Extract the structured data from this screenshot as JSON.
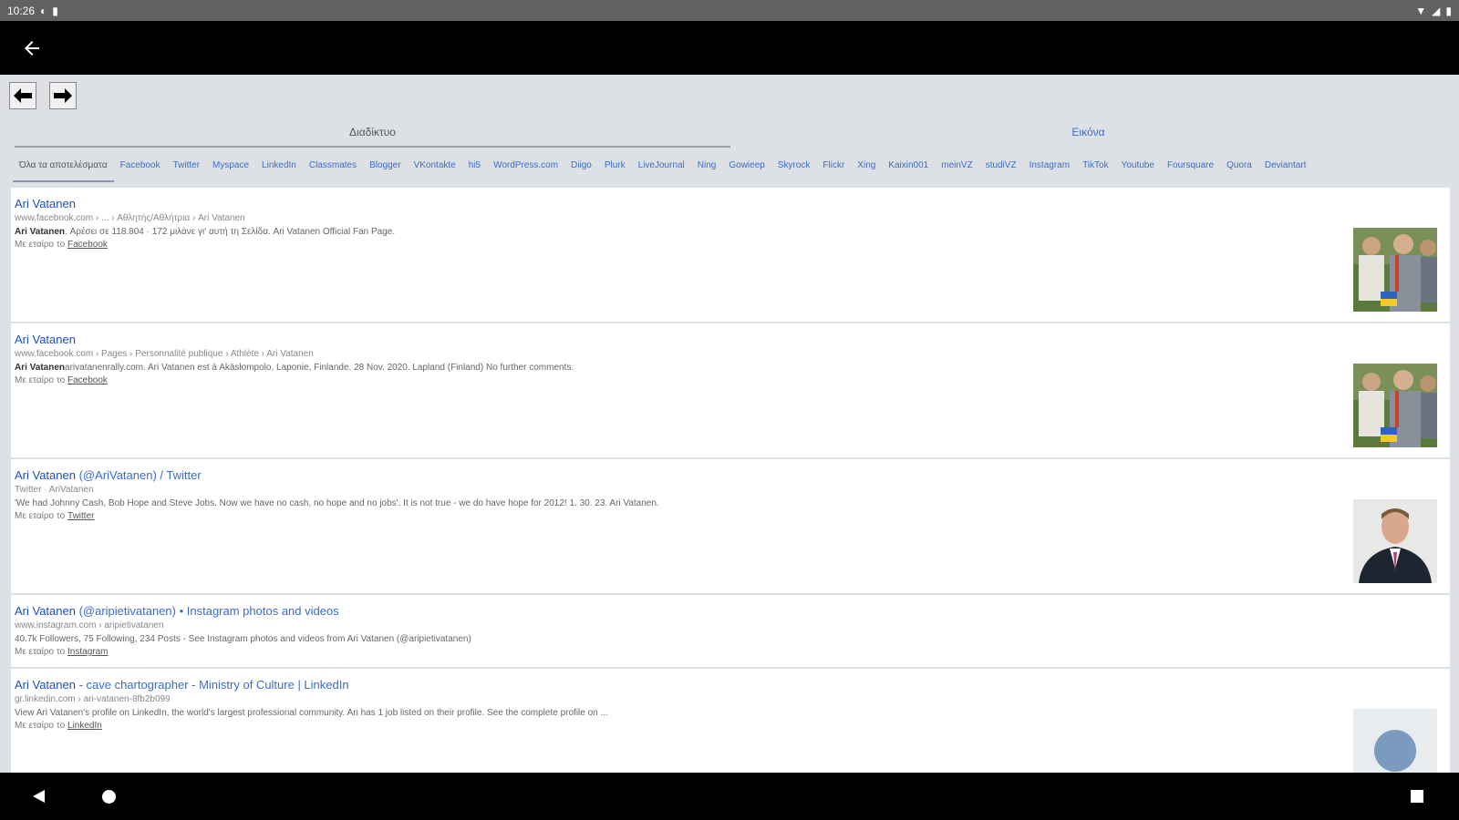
{
  "statusbar": {
    "time": "10:26"
  },
  "tabs": [
    "Διαδίκτυο",
    "Εικόνα"
  ],
  "chips": [
    "Όλα τα αποτελέσματα",
    "Facebook",
    "Twitter",
    "Myspace",
    "LinkedIn",
    "Classmates",
    "Blogger",
    "VKontakte",
    "hi5",
    "WordPress.com",
    "Diigo",
    "Plurk",
    "LiveJournal",
    "Ning",
    "Gowieep",
    "Skyrock",
    "Flickr",
    "Xing",
    "Kaixin001",
    "meinVZ",
    "studiVZ",
    "Instagram",
    "TikTok",
    "Youtube",
    "Foursquare",
    "Quora",
    "Deviantart"
  ],
  "results": [
    {
      "title": "Ari Vatanen",
      "title_rest": "",
      "url": "www.facebook.com › ... › Αθλητής/Αθλήτρια › Ari Vatanen",
      "snippet_bold": "Ari Vatanen",
      "snippet": ". Αρέσει σε 118.804 · 172 μιλάνε γι' αυτή τη Σελίδα. Ari Vatanen Official Fan Page.",
      "via": "Με εταίρο το ",
      "via_site": "Facebook",
      "thumb": "crowd"
    },
    {
      "title": "Ari Vatanen",
      "title_rest": "",
      "url": "www.facebook.com › Pages › Personnalité publique › Athlète › Ari Vatanen",
      "snippet_bold": "Ari Vatanen",
      "snippet": "arivatanenrally.com. Ari Vatanen est à Akäslompolo, Laponie, Finlande. 28 Nov. 2020. Lapland (Finland) No further comments.",
      "via": "Με εταίρο το ",
      "via_site": "Facebook",
      "thumb": "crowd"
    },
    {
      "title": "Ari Vatanen",
      "title_rest": " (@AriVatanen) / Twitter",
      "url": "Twitter · AriVatanen",
      "snippet_bold": "",
      "snippet": "'We had Johnny Cash, Bob Hope and Steve Jobs. Now we have no cash, no hope and no jobs'. It is not true - we do have hope for 2012! 1. 30. 23. Ari Vatanen.",
      "via": "Με εταίρο το ",
      "via_site": "Twitter",
      "thumb": "portrait"
    },
    {
      "title": "Ari Vatanen",
      "title_rest": " (@aripietivatanen) • Instagram photos and videos",
      "url": "www.instagram.com › aripietivatanen",
      "snippet_bold": "",
      "snippet": "40.7k Followers, 75 Following, 234 Posts - See Instagram photos and videos from Ari Vatanen (@aripietivatanen)",
      "via": "Με εταίρο το ",
      "via_site": "Instagram",
      "thumb": ""
    },
    {
      "title": "Ari Vatanen",
      "title_rest": " - cave chartographer - Ministry of Culture | LinkedIn",
      "url": "gr.linkedin.com › ari-vatanen-8fb2b099",
      "snippet_bold": "",
      "snippet": "View Ari Vatanen's profile on LinkedIn, the world's largest professional community. Ari has 1 job listed on their profile. See the complete profile on ...",
      "via": "Με εταίρο το ",
      "via_site": "LinkedIn",
      "thumb": "avatar"
    }
  ]
}
